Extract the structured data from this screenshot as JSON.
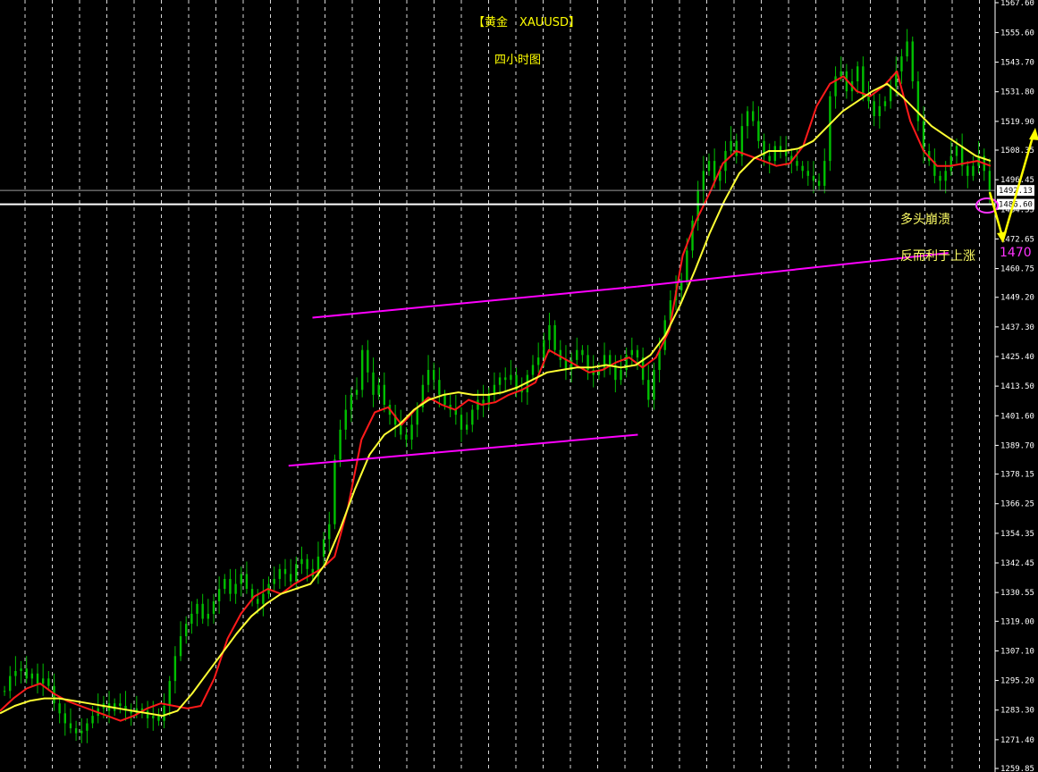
{
  "chart_data": {
    "type": "candlestick",
    "title": "【黄金　XAUUSD】",
    "subtitle": "四小时图",
    "colors": {
      "background": "#000000",
      "candle_up": "#00c000",
      "candle_down": "#00c000",
      "ma_fast": "#ff1a1a",
      "ma_slow": "#ffff33",
      "channel": "#ff00ff",
      "grid": "#ffffff",
      "title": "#ffff00",
      "annotation_text": "#ffff66",
      "annotation_target": "#ff33ff",
      "arrow": "#ffff00",
      "level_line": "#ffffff"
    },
    "y_axis": {
      "min": 1259.5,
      "max": 1567.6,
      "ticks": [
        "1567.60",
        "1555.60",
        "1543.70",
        "1531.80",
        "1519.90",
        "1508.35",
        "1496.45",
        "1484.55",
        "1472.65",
        "1460.75",
        "1449.20",
        "1437.30",
        "1425.40",
        "1413.50",
        "1401.60",
        "1389.70",
        "1378.15",
        "1366.25",
        "1354.35",
        "1342.45",
        "1330.55",
        "1319.00",
        "1307.10",
        "1295.20",
        "1283.30",
        "1271.40",
        "1259.85"
      ],
      "tick_values": [
        1567.6,
        1555.6,
        1543.7,
        1531.8,
        1519.9,
        1508.35,
        1496.45,
        1484.55,
        1472.65,
        1460.75,
        1449.2,
        1437.3,
        1425.4,
        1413.5,
        1401.6,
        1389.7,
        1378.15,
        1366.25,
        1354.35,
        1342.45,
        1330.55,
        1319.0,
        1307.1,
        1295.2,
        1283.3,
        1271.4,
        1259.85
      ]
    },
    "grid": true,
    "price_markers": [
      {
        "label": "1492.13",
        "value": 1492.13
      },
      {
        "label": "1486.60",
        "value": 1486.6
      }
    ],
    "close_series": [
      1291,
      1297,
      1299,
      1300,
      1296,
      1298,
      1294,
      1296,
      1293,
      1286,
      1282,
      1278,
      1276,
      1274,
      1275,
      1278,
      1281,
      1284,
      1286,
      1283,
      1286,
      1285,
      1283,
      1282,
      1284,
      1283,
      1280,
      1281,
      1279,
      1285,
      1295,
      1305,
      1313,
      1318,
      1322,
      1326,
      1320,
      1322,
      1327,
      1332,
      1336,
      1330,
      1334,
      1338,
      1332,
      1328,
      1326,
      1330,
      1334,
      1336,
      1340,
      1338,
      1335,
      1342,
      1344,
      1340,
      1337,
      1345,
      1352,
      1358,
      1384,
      1396,
      1404,
      1410,
      1412,
      1428,
      1419,
      1410,
      1414,
      1406,
      1402,
      1398,
      1394,
      1392,
      1398,
      1405,
      1414,
      1420,
      1416,
      1410,
      1406,
      1404,
      1402,
      1396,
      1398,
      1404,
      1408,
      1406,
      1410,
      1414,
      1417,
      1416,
      1418,
      1412,
      1411,
      1418,
      1422,
      1425,
      1432,
      1438,
      1428,
      1424,
      1420,
      1424,
      1428,
      1426,
      1420,
      1418,
      1420,
      1426,
      1422,
      1416,
      1420,
      1426,
      1428,
      1425,
      1416,
      1408,
      1420,
      1428,
      1440,
      1448,
      1452,
      1456,
      1468,
      1480,
      1492,
      1500,
      1504,
      1496,
      1500,
      1508,
      1512,
      1506,
      1518,
      1524,
      1520,
      1512,
      1506,
      1504,
      1510,
      1508,
      1506,
      1504,
      1502,
      1500,
      1498,
      1496,
      1494,
      1504,
      1530,
      1538,
      1540,
      1532,
      1536,
      1542,
      1530,
      1528,
      1522,
      1526,
      1528,
      1534,
      1540,
      1546,
      1552,
      1536,
      1520,
      1508,
      1504,
      1498,
      1496,
      1500,
      1506,
      1510,
      1502,
      1498,
      1502,
      1506,
      1500,
      1492
    ],
    "series": [
      {
        "name": "",
        "kind": "ma_fast",
        "color": "#ff1a1a",
        "values": [
          1283,
          1288,
          1292,
          1294,
          1290,
          1287,
          1285,
          1283,
          1281,
          1279,
          1281,
          1284,
          1286,
          1285,
          1284,
          1285,
          1296,
          1312,
          1322,
          1329,
          1332,
          1330,
          1334,
          1337,
          1340,
          1345,
          1365,
          1392,
          1403,
          1405,
          1398,
          1404,
          1409,
          1406,
          1404,
          1408,
          1406,
          1407,
          1410,
          1412,
          1415,
          1428,
          1425,
          1422,
          1419,
          1420,
          1423,
          1425,
          1421,
          1425,
          1436,
          1466,
          1480,
          1491,
          1503,
          1508,
          1506,
          1504,
          1502,
          1503,
          1510,
          1526,
          1535,
          1538,
          1532,
          1530,
          1534,
          1540,
          1520,
          1508,
          1502,
          1502,
          1503,
          1504,
          1502
        ]
      },
      {
        "name": "",
        "kind": "ma_slow",
        "color": "#ffff33",
        "values": [
          1282,
          1285,
          1287,
          1288,
          1288,
          1287,
          1286,
          1285,
          1284,
          1283,
          1282,
          1281,
          1283,
          1290,
          1298,
          1306,
          1314,
          1321,
          1326,
          1330,
          1332,
          1334,
          1342,
          1356,
          1372,
          1386,
          1394,
          1398,
          1404,
          1408,
          1410,
          1411,
          1410,
          1410,
          1411,
          1413,
          1416,
          1419,
          1420,
          1421,
          1421,
          1422,
          1421,
          1422,
          1426,
          1434,
          1446,
          1460,
          1475,
          1488,
          1499,
          1505,
          1508,
          1508,
          1509,
          1512,
          1518,
          1524,
          1528,
          1532,
          1535,
          1530,
          1524,
          1518,
          1514,
          1510,
          1506,
          1504
        ]
      }
    ],
    "lines": [
      {
        "name": "channel-upper",
        "from": [
          0.314,
          1441.0
        ],
        "to": [
          0.64,
          1453.5
        ]
      },
      {
        "name": "channel-lower",
        "from": [
          0.29,
          1381.5
        ],
        "to": [
          0.641,
          1394.0
        ]
      },
      {
        "name": "breakout-line",
        "from": [
          0.64,
          1453.5
        ],
        "to": [
          0.953,
          1467.0
        ]
      }
    ],
    "annotations": {
      "collapse_text": "多头崩溃",
      "rise_text": "反而利于上涨",
      "target_label": "1470",
      "target_value": 1470
    }
  }
}
